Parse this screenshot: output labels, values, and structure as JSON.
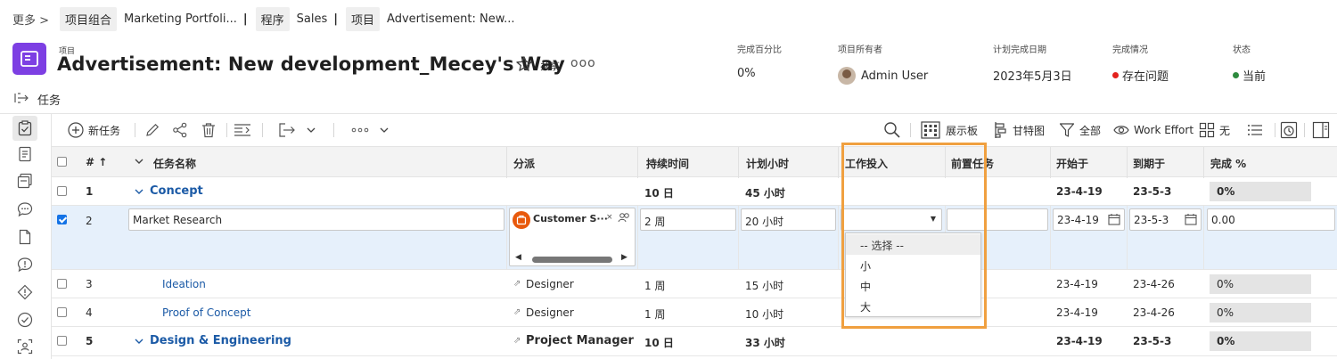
{
  "breadcrumb": {
    "more_label": "更多 >",
    "items": [
      {
        "type": "项目组合",
        "name": "Marketing Portfoli..."
      },
      {
        "type": "程序",
        "name": "Sales"
      },
      {
        "type": "项目",
        "name": "Advertisement: New..."
      }
    ]
  },
  "header": {
    "kind_label": "项目",
    "title": "Advertisement: New development_Mecey's Way",
    "share_label": "共享",
    "more_label": "ooo",
    "meta": [
      {
        "label": "完成百分比",
        "value": "0%"
      },
      {
        "label": "项目所有者",
        "value": "Admin User"
      },
      {
        "label": "计划完成日期",
        "value": "2023年5月3日"
      },
      {
        "label": "完成情况",
        "value": "存在问题",
        "color": "#e3211c"
      },
      {
        "label": "状态",
        "value": "当前",
        "color": "#2d8a3e"
      }
    ]
  },
  "section": {
    "title": "任务"
  },
  "toolbar": {
    "new_task": "新任务",
    "board": "展示板",
    "gantt": "甘特图",
    "filter": "全部",
    "work_effort": "Work Effort",
    "grouping": "无"
  },
  "table": {
    "columns": {
      "num": "# ↑",
      "name": "任务名称",
      "assign": "分派",
      "duration": "持续时间",
      "planned_hours": "计划小时",
      "work_effort": "工作投入",
      "predecessors": "前置任务",
      "start": "开始于",
      "due": "到期于",
      "percent": "完成 %"
    },
    "rows": [
      {
        "num": "1",
        "name": "Concept",
        "assign": "",
        "duration": "10 日",
        "hours": "45 小时",
        "start": "23-4-19",
        "due": "23-5-3",
        "percent": "0%"
      },
      {
        "num": "2",
        "name": "Market Research",
        "assign": "Customer S···",
        "duration": "2 周",
        "hours": "20 小时",
        "start": "23-4-19",
        "due": "23-5-3",
        "percent": "0.00"
      },
      {
        "num": "3",
        "name": "Ideation",
        "assign": "Designer",
        "duration": "1 周",
        "hours": "15 小时",
        "start": "23-4-19",
        "due": "23-4-26",
        "percent": "0%"
      },
      {
        "num": "4",
        "name": "Proof of Concept",
        "assign": "Designer",
        "duration": "1 周",
        "hours": "10 小时",
        "start": "23-4-19",
        "due": "23-4-26",
        "percent": "0%"
      },
      {
        "num": "5",
        "name": "Design & Engineering",
        "assign": "Project Manager",
        "duration": "10 日",
        "hours": "33 小时",
        "start": "23-4-19",
        "due": "23-5-3",
        "percent": "0%"
      }
    ]
  },
  "work_effort_dropdown": {
    "options": [
      "-- 选择 --",
      "小",
      "中",
      "大"
    ]
  },
  "colors": {
    "project_icon": "#7d3fe3",
    "selected_row": "#e6f0fb",
    "highlight_border": "#f0a040",
    "link": "#1b5aa6",
    "assignee_badge": "#e8590c"
  }
}
